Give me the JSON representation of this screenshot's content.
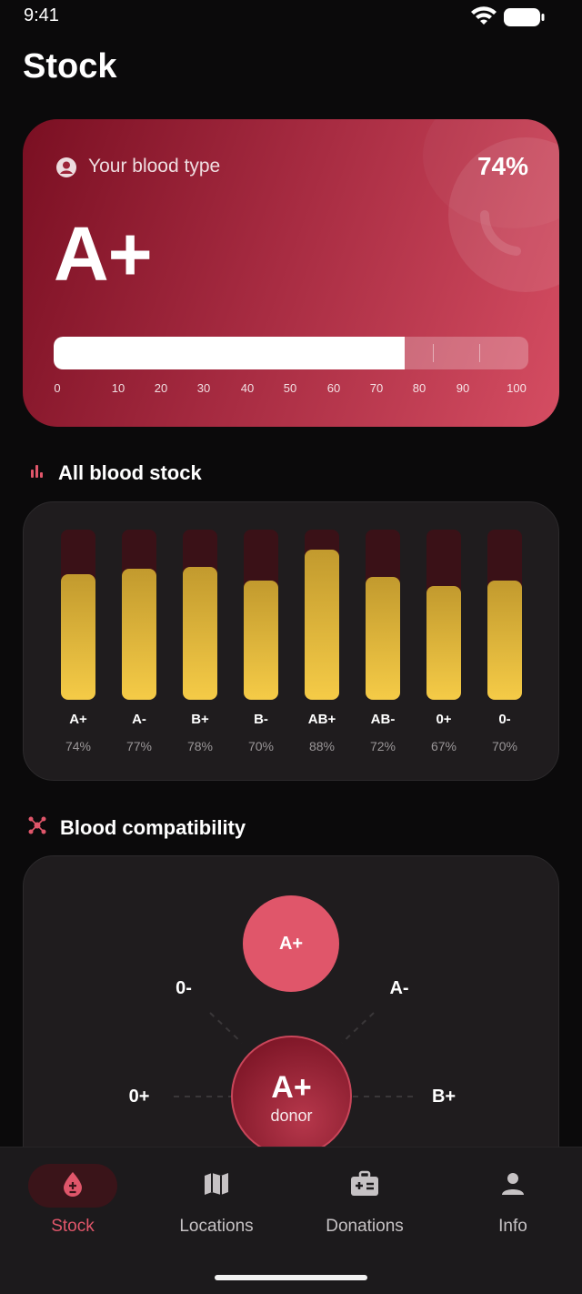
{
  "status_bar": {
    "time": "9:41"
  },
  "page_title": "Stock",
  "hero": {
    "label": "Your blood type",
    "blood_type": "A+",
    "percentage_label": "74%",
    "level": 0.74,
    "scale": [
      "0",
      "10",
      "20",
      "30",
      "40",
      "50",
      "60",
      "70",
      "80",
      "90",
      "100"
    ]
  },
  "stock_section": {
    "title": "All blood stock",
    "chart_data": {
      "type": "bar",
      "categories": [
        "A+",
        "A-",
        "B+",
        "B-",
        "AB+",
        "AB-",
        "0+",
        "0-"
      ],
      "values": [
        74,
        77,
        78,
        70,
        88,
        72,
        67,
        70
      ],
      "value_labels": [
        "74%",
        "77%",
        "78%",
        "70%",
        "88%",
        "72%",
        "67%",
        "70%"
      ],
      "ylim": [
        0,
        100
      ],
      "colors": {
        "fill": "#f5cb47",
        "track": "#3a1117"
      }
    }
  },
  "compat_section": {
    "title": "Blood compatibility",
    "receiver": "A+",
    "donor_type": "A+",
    "donor_label": "donor",
    "compatible": {
      "left_top": "0-",
      "right_top": "A-",
      "left_bottom": "0+",
      "right_bottom": "B+"
    }
  },
  "nav": {
    "items": [
      {
        "label": "Stock",
        "icon": "blood-drop-icon",
        "active": true
      },
      {
        "label": "Locations",
        "icon": "map-icon",
        "active": false
      },
      {
        "label": "Donations",
        "icon": "medical-kit-icon",
        "active": false
      },
      {
        "label": "Info",
        "icon": "person-icon",
        "active": false
      }
    ]
  },
  "colors": {
    "accent": "#e0566a",
    "background": "#0b0a0b",
    "card": "#1f1c1e"
  }
}
